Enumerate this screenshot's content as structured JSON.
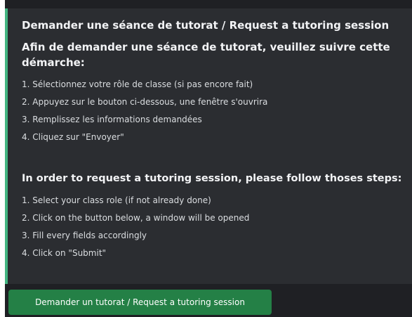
{
  "embed": {
    "title": "Demander une séance de tutorat / Request a tutoring session",
    "accent_color": "#43b581",
    "fr": {
      "heading": "Afin de demander une séance de tutorat, veuillez suivre cette démarche:",
      "steps": [
        "1. Sélectionnez votre rôle de classe (si pas encore fait)",
        "2. Appuyez sur le bouton ci-dessous, une fenêtre s'ouvrira",
        "3. Remplissez les informations demandées",
        "4. Cliquez sur \"Envoyer\""
      ]
    },
    "en": {
      "heading": "In order to request a tutoring session, please follow thoses steps:",
      "steps": [
        "1. Select your class role (if not already done)",
        "2. Click on the button below, a window will be opened",
        "3. Fill every fields accordingly",
        "4. Click on \"Submit\""
      ]
    }
  },
  "button": {
    "label": "Demander un tutorat / Request a tutoring session",
    "color": "#248046"
  }
}
